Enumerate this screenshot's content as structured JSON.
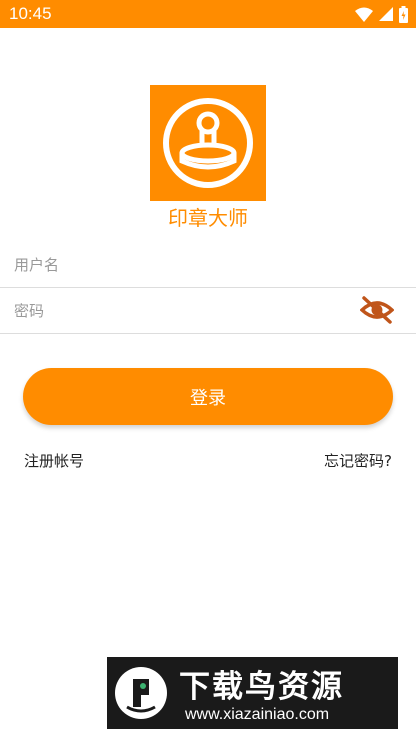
{
  "status_bar": {
    "time": "10:45"
  },
  "app": {
    "name": "印章大师"
  },
  "form": {
    "username_placeholder": "用户名",
    "password_placeholder": "密码"
  },
  "actions": {
    "login_label": "登录",
    "register_label": "注册帐号",
    "forgot_label": "忘记密码?"
  },
  "watermark": {
    "title": "下载鸟资源",
    "url": "www.xiazainiao.com"
  },
  "colors": {
    "accent": "#ff8c00",
    "eye_icon": "#c0551a",
    "divider": "#dddddd",
    "watermark_bg": "#1a1a1a"
  },
  "icons": [
    "wifi-icon",
    "signal-icon",
    "battery-icon",
    "stamp-icon",
    "eye-off-icon",
    "watermark-logo-icon"
  ]
}
